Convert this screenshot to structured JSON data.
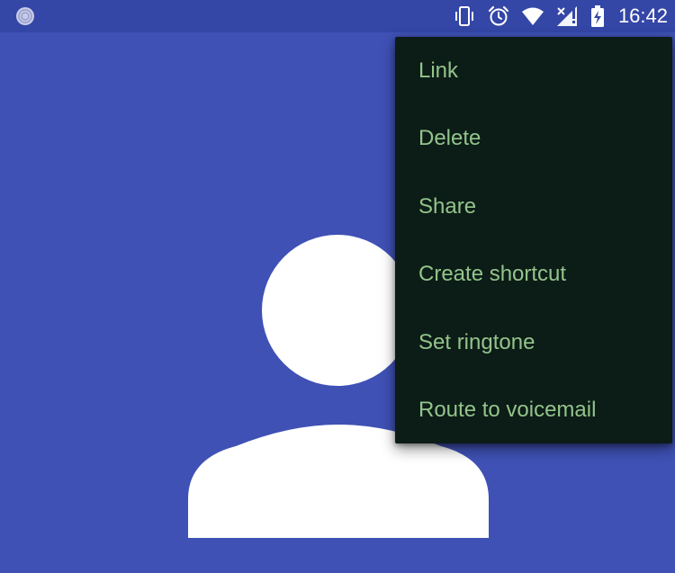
{
  "status_bar": {
    "time": "16:42",
    "icons": [
      "fingerprint-notification-icon",
      "vibrate-icon",
      "alarm-icon",
      "wifi-icon",
      "signal-no-data-icon",
      "battery-charging-icon"
    ]
  },
  "contact": {
    "avatar_icon": "person-placeholder-icon"
  },
  "overflow_menu": {
    "items": [
      {
        "label": "Link"
      },
      {
        "label": "Delete"
      },
      {
        "label": "Share"
      },
      {
        "label": "Create shortcut"
      },
      {
        "label": "Set ringtone"
      },
      {
        "label": "Route to voicemail"
      }
    ]
  },
  "colors": {
    "background": "#3f51b5",
    "status_bar": "#3446a6",
    "menu_background": "#0c1c17",
    "menu_text": "#93c48b"
  }
}
